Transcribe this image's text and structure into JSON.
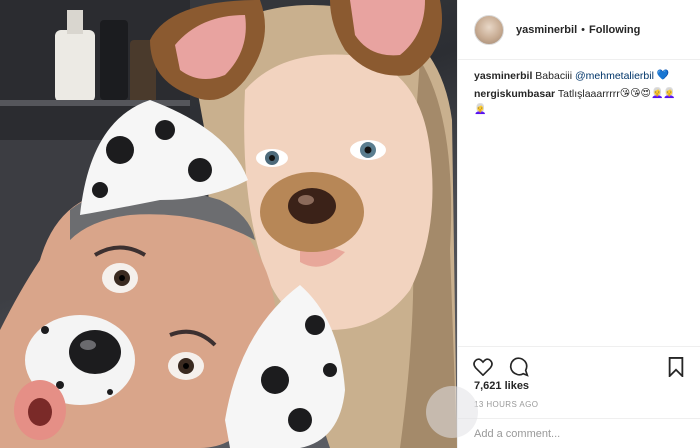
{
  "header": {
    "username": "yasminerbil",
    "separator": "•",
    "follow_status": "Following"
  },
  "comments": [
    {
      "user": "yasminerbil",
      "text": "Babaciii",
      "mention": "@mehmetalierbil",
      "emoji": "💙"
    },
    {
      "user": "nergiskumbasar",
      "text": "Tatlışlaaarrrrr",
      "emoji": "😘😘😍👩‍🦳👩‍🦳",
      "emoji2": "👩‍🦳"
    }
  ],
  "actions": {
    "like_icon": "heart-icon",
    "comment_icon": "comment-icon",
    "save_icon": "bookmark-icon"
  },
  "likes": "7,621 likes",
  "timestamp": "13 HOURS AGO",
  "comment_input": {
    "placeholder": "Add a comment..."
  },
  "colors": {
    "mention": "#003569",
    "heart_emoji": "#3897f0",
    "border": "#efefef"
  }
}
